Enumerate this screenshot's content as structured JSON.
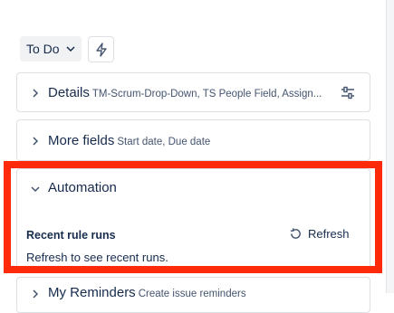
{
  "status": {
    "label": "To Do"
  },
  "panels": {
    "details": {
      "title": "Details",
      "subtitle": "TM-Scrum-Drop-Down, TS People Field, Assign..."
    },
    "more_fields": {
      "title": "More fields",
      "subtitle": "Start date, Due date"
    },
    "automation": {
      "title": "Automation",
      "rule_runs_label": "Recent rule runs",
      "refresh_label": "Refresh",
      "hint": "Refresh to see recent runs."
    },
    "reminders": {
      "title": "My Reminders",
      "subtitle": "Create issue reminders"
    }
  },
  "highlight_color": "#ff2a0a"
}
